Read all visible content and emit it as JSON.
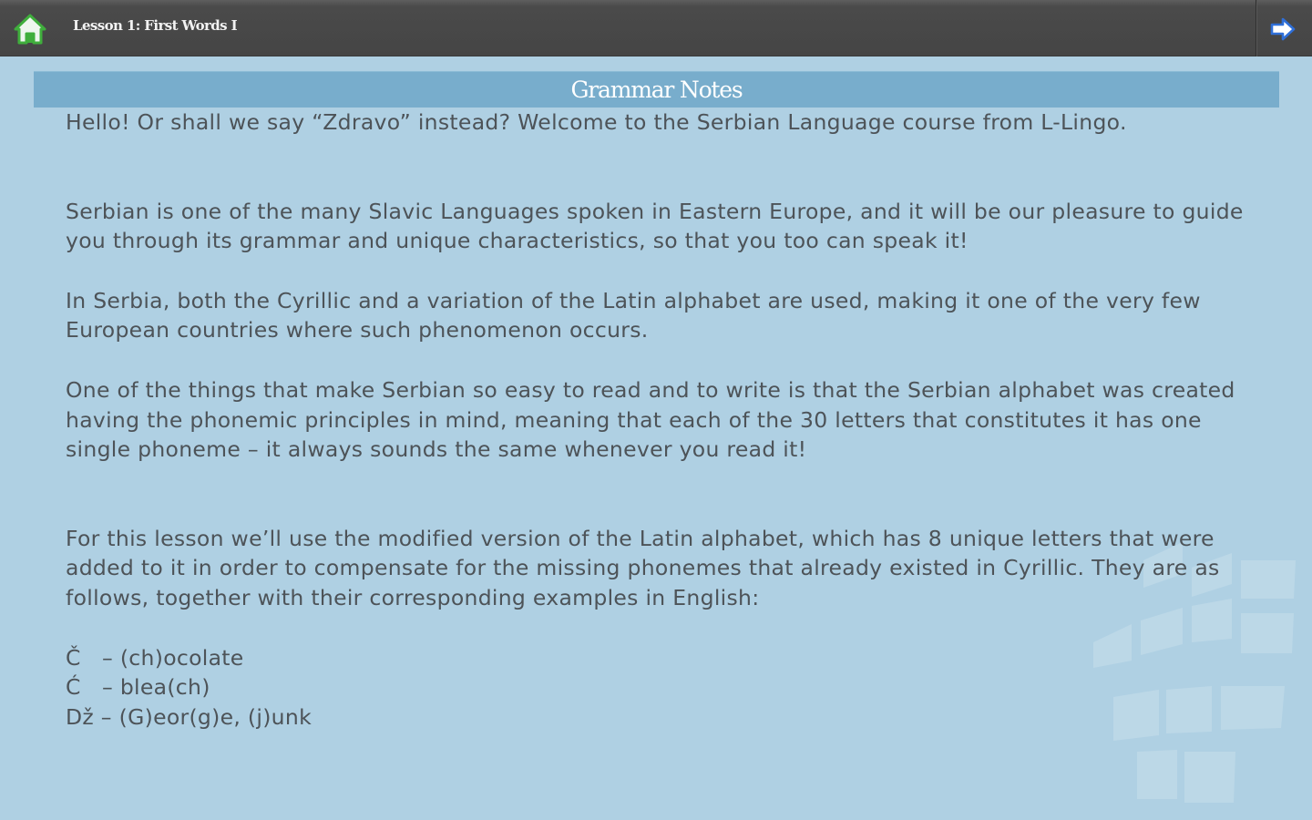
{
  "header": {
    "home_icon": "home-icon",
    "lesson_title": "Lesson 1: First Words I",
    "next_icon": "arrow-right-icon"
  },
  "section": {
    "title": "Grammar Notes"
  },
  "content": {
    "paragraphs": [
      "Hello!  Or shall we say “Zdravo” instead?  Welcome to the Serbian Language course from L-Lingo.",
      "Serbian is one of the many Slavic Languages spoken in Eastern Europe, and it will be our pleasure to guide you through its grammar and unique characteristics, so that you too can speak it!",
      "In Serbia, both the Cyrillic and a variation of the Latin alphabet are used, making it one of the very few European countries where such phenomenon occurs.",
      "One of the things that make Serbian so easy to read and to write is that the Serbian alphabet was created having the phonemic principles in mind, meaning that each of the 30 letters that constitutes it has one single phoneme – it always sounds the same whenever you read it!",
      "For this lesson we’ll use the modified version of the Latin alphabet, which has 8 unique letters that were added to it in order to compensate for the missing phonemes that already existed in Cyrillic.  They are as follows, together with their corresponding examples in English:"
    ],
    "letters": [
      "Č   – (ch)ocolate",
      "Ć   – blea(ch)",
      "Dž – (G)eor(g)e, (j)unk"
    ]
  },
  "colors": {
    "background": "#afd0e3",
    "topbar": "#454545",
    "section_bar": "#78adcc",
    "text": "#4d5358",
    "home_icon_green": "#3fae3c",
    "next_icon_blue": "#2f6fd8"
  }
}
